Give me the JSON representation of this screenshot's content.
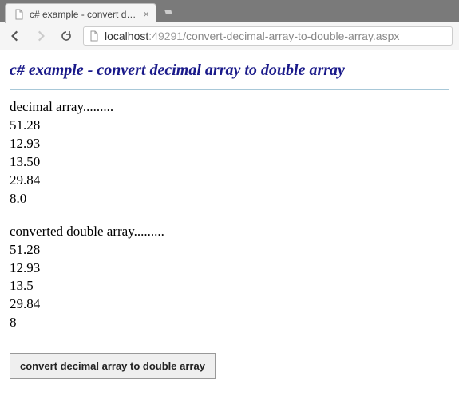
{
  "browser": {
    "tab_title": "c# example - convert deci",
    "tab_close": "×",
    "new_tab": "▸",
    "url": {
      "host": "localhost",
      "port": ":49291",
      "path": "/convert-decimal-array-to-double-array.aspx"
    }
  },
  "page": {
    "heading": "c# example - convert decimal array to double array",
    "label_decimal": "decimal array.........",
    "decimal_values": [
      "51.28",
      "12.93",
      "13.50",
      "29.84",
      "8.0"
    ],
    "label_double": "converted double array.........",
    "double_values": [
      "51.28",
      "12.93",
      "13.5",
      "29.84",
      "8"
    ],
    "button_label": "convert decimal array to double array"
  }
}
